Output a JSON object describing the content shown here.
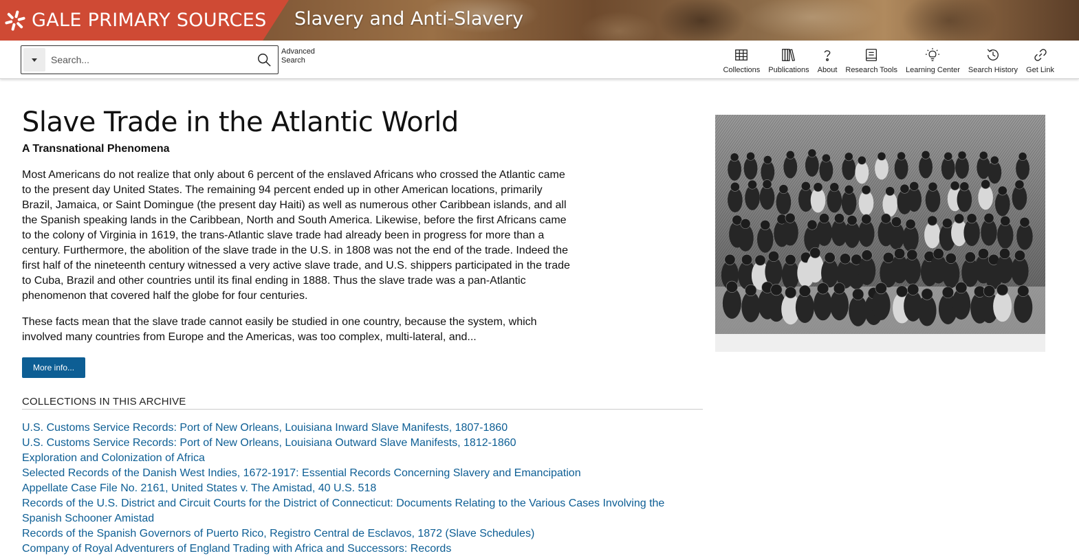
{
  "banner": {
    "brand": "GALE PRIMARY SOURCES",
    "archive_title": "Slavery and Anti-Slavery",
    "brand_color": "#cf4a34"
  },
  "toolbar": {
    "search_placeholder": "Search...",
    "advanced_search_line1": "Advanced",
    "advanced_search_line2": "Search",
    "tools": [
      {
        "label": "Collections",
        "icon": "grid-icon"
      },
      {
        "label": "Publications",
        "icon": "books-icon"
      },
      {
        "label": "About",
        "icon": "question-icon"
      },
      {
        "label": "Research Tools",
        "icon": "notebook-icon"
      },
      {
        "label": "Learning Center",
        "icon": "lightbulb-icon"
      },
      {
        "label": "Search History",
        "icon": "history-icon"
      },
      {
        "label": "Get Link",
        "icon": "link-icon"
      }
    ]
  },
  "main": {
    "title": "Slave Trade in the Atlantic World",
    "subtitle": "A Transnational Phenomena",
    "paragraphs": [
      "Most Americans do not realize that only about 6 percent of the enslaved Africans who crossed the Atlantic came to the present day United States. The remaining 94 percent ended up in other American locations, primarily Brazil, Jamaica, or Saint Domingue (the present day Haiti) as well as numerous other Caribbean islands, and all the Spanish speaking lands in the Caribbean, North and South America. Likewise, before the first Africans came to the colony of Virginia in 1619, the trans-Atlantic slave trade had already been in progress for more than a century. Furthermore, the abolition of the slave trade in the U.S. in 1808 was not the end of the trade. Indeed the first half of the nineteenth century witnessed a very active slave trade, and U.S. shippers participated in the trade to Cuba, Brazil and other countries until its final ending in 1888. Thus the slave trade was a pan-Atlantic phenomenon that covered half the globe for four centuries.",
      "These facts mean that the slave trade cannot easily be studied in one country, because the system, which involved many countries from Europe and the Americas, was too complex, multi-lateral, and..."
    ],
    "more_info_label": "More info...",
    "collections_heading": "COLLECTIONS IN THIS ARCHIVE",
    "collections": [
      "U.S. Customs Service Records: Port of New Orleans, Louisiana Inward Slave Manifests, 1807-1860",
      "U.S. Customs Service Records: Port of New Orleans, Louisiana Outward Slave Manifests, 1812-1860",
      "Exploration and Colonization of Africa",
      "Selected Records of the Danish West Indies, 1672-1917: Essential Records Concerning Slavery and Emancipation",
      "Appellate Case File No. 2161, United States v. The Amistad, 40 U.S. 518",
      "Records of the U.S. District and Circuit Courts for the District of Connecticut: Documents Relating to the Various Cases Involving the Spanish Schooner Amistad",
      "Records of the Spanish Governors of Puerto Rico, Registro Central de Esclavos, 1872 (Slave Schedules)",
      "Company of Royal Adventurers of England Trading with Africa and Successors: Records"
    ],
    "link_color": "#0d5e94",
    "button_color": "#0d5e94"
  }
}
